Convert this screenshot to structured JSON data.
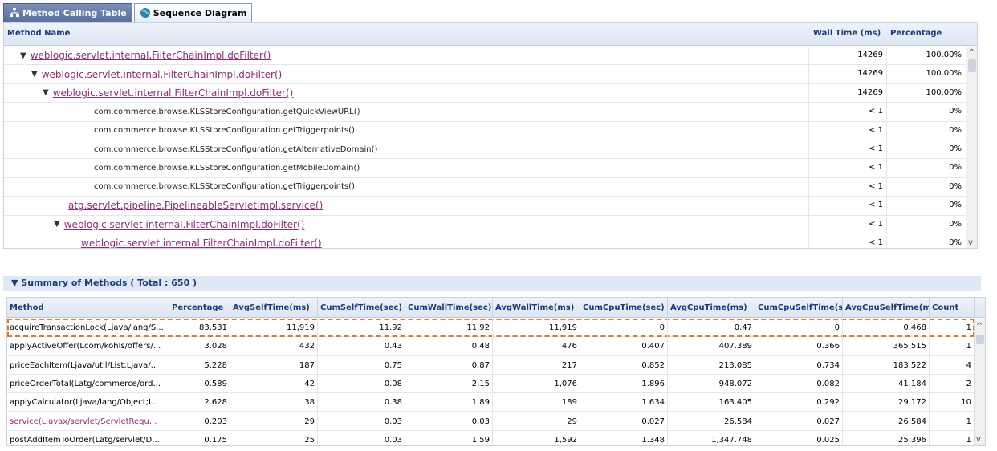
{
  "tabs": [
    {
      "label": "Method Calling Table",
      "icon": "tree-icon",
      "active": true
    },
    {
      "label": "Sequence Diagram",
      "icon": "globe-icon",
      "active": false
    }
  ],
  "method_table": {
    "headers": {
      "method": "Method Name",
      "wall": "Wall Time (ms)",
      "pct": "Percentage"
    },
    "rows": [
      {
        "name": "weblogic.servlet.internal.FilterChainImpl.doFilter()",
        "wall": "14269",
        "pct": "100.00%",
        "link": true,
        "tree": "expanded"
      },
      {
        "name": "weblogic.servlet.internal.FilterChainImpl.doFilter()",
        "wall": "14269",
        "pct": "100.00%",
        "link": true,
        "tree": "expanded"
      },
      {
        "name": "weblogic.servlet.internal.FilterChainImpl.doFilter()",
        "wall": "14269",
        "pct": "100.00%",
        "link": true,
        "tree": "expanded"
      },
      {
        "name": "com.commerce.browse.KLSStoreConfiguration.getQuickViewURL()",
        "wall": "< 1",
        "pct": "0%",
        "link": false,
        "tree": "none"
      },
      {
        "name": "com.commerce.browse.KLSStoreConfiguration.getTriggerpoints()",
        "wall": "< 1",
        "pct": "0%",
        "link": false,
        "tree": "none"
      },
      {
        "name": "com.commerce.browse.KLSStoreConfiguration.getAlternativeDomain()",
        "wall": "< 1",
        "pct": "0%",
        "link": false,
        "tree": "none"
      },
      {
        "name": "com.commerce.browse.KLSStoreConfiguration.getMobileDomain()",
        "wall": "< 1",
        "pct": "0%",
        "link": false,
        "tree": "none"
      },
      {
        "name": "com.commerce.browse.KLSStoreConfiguration.getTriggerpoints()",
        "wall": "< 1",
        "pct": "0%",
        "link": false,
        "tree": "none"
      },
      {
        "name": "atg.servlet.pipeline.PipelineableServletImpl.service()",
        "wall": "< 1",
        "pct": "0%",
        "link": true,
        "tree": "none"
      },
      {
        "name": "weblogic.servlet.internal.FilterChainImpl.doFilter()",
        "wall": "< 1",
        "pct": "0%",
        "link": true,
        "tree": "expanded"
      },
      {
        "name": "weblogic.servlet.internal.FilterChainImpl.doFilter()",
        "wall": "< 1",
        "pct": "0%",
        "link": true,
        "tree": "none"
      }
    ]
  },
  "summary": {
    "title": "Summary of Methods ( Total : 650 )",
    "headers": [
      "Method",
      "Percentage",
      "AvgSelfTime(ms)",
      "CumSelfTime(sec)",
      "CumWallTime(sec)",
      "AvgWallTime(ms)",
      "CumCpuTime(sec)",
      "AvgCpuTime(ms)",
      "CumCpuSelfTime(se",
      "AvgCpuSelfTime(ms",
      "Count"
    ],
    "rows": [
      [
        "acquireTransactionLock(Ljava/lang/S...",
        "83.531",
        "11,919",
        "11.92",
        "11.92",
        "11,919",
        "0",
        "0.47",
        "0",
        "0.468",
        "1"
      ],
      [
        "applyActiveOffer(Lcom/kohls/offers/...",
        "3.028",
        "432",
        "0.43",
        "0.48",
        "476",
        "0.407",
        "407.389",
        "0.366",
        "365.515",
        "1"
      ],
      [
        "priceEachItem(Ljava/util/List;Ljava/...",
        "5.228",
        "187",
        "0.75",
        "0.87",
        "217",
        "0.852",
        "213.085",
        "0.734",
        "183.522",
        "4"
      ],
      [
        "priceOrderTotal(Latg/commerce/ord...",
        "0.589",
        "42",
        "0.08",
        "2.15",
        "1,076",
        "1.896",
        "948.072",
        "0.082",
        "41.184",
        "2"
      ],
      [
        "applyCalculator(Ljava/lang/Object;I...",
        "2.628",
        "38",
        "0.38",
        "1.89",
        "189",
        "1.634",
        "163.405",
        "0.292",
        "29.172",
        "10"
      ],
      [
        "service(Ljavax/servlet/ServletRequ...",
        "0.203",
        "29",
        "0.03",
        "0.03",
        "29",
        "0.027",
        "26.584",
        "0.027",
        "26.584",
        "1"
      ],
      [
        "postAddItemToOrder(Latg/servlet/D...",
        "0.175",
        "25",
        "0.03",
        "1.59",
        "1,592",
        "1.348",
        "1,347.748",
        "0.025",
        "25.396",
        "1"
      ]
    ]
  }
}
